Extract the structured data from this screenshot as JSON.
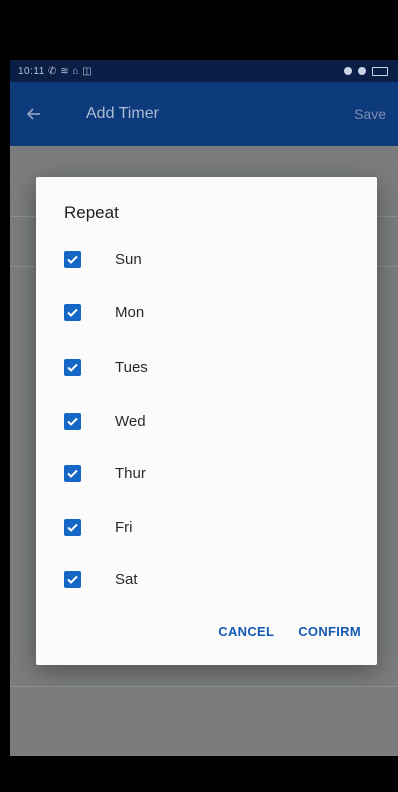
{
  "status_bar": {
    "time_text": "10:11 ✆ ≋ ⌂ ◫"
  },
  "app_bar": {
    "title": "Add Timer",
    "save_label": "Save"
  },
  "dialog": {
    "title": "Repeat",
    "options": [
      {
        "label": "Sun",
        "checked": true
      },
      {
        "label": "Mon",
        "checked": true
      },
      {
        "label": "Tues",
        "checked": true
      },
      {
        "label": "Wed",
        "checked": true
      },
      {
        "label": "Thur",
        "checked": true
      },
      {
        "label": "Fri",
        "checked": true
      },
      {
        "label": "Sat",
        "checked": true
      }
    ],
    "cancel_label": "CANCEL",
    "confirm_label": "CONFIRM"
  },
  "colors": {
    "accent": "#1567c5",
    "app_bar": "#0d3a7a",
    "scrim": "#7a7d7c"
  }
}
